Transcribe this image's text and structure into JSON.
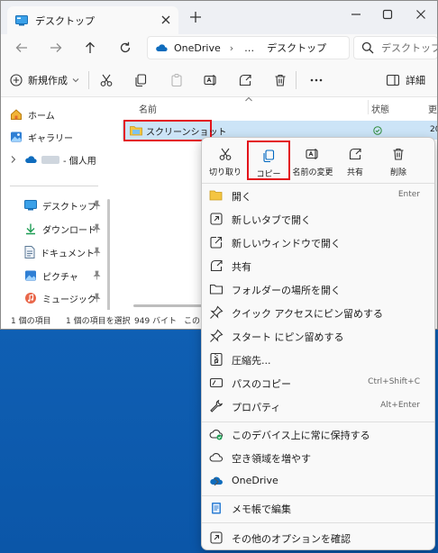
{
  "window": {
    "tab_title": "デスクトップ",
    "address_root": "OneDrive",
    "address_more": "…",
    "address_current": "デスクトップ",
    "search_placeholder": "デスクトップ"
  },
  "commandbar": {
    "new_label": "新規作成",
    "details_label": "詳細"
  },
  "sidebar": {
    "items": [
      {
        "label": "ホーム"
      },
      {
        "label": "ギャラリー"
      },
      {
        "label": "- 個人用"
      },
      {
        "label": "デスクトップ"
      },
      {
        "label": "ダウンロード"
      },
      {
        "label": "ドキュメント"
      },
      {
        "label": "ピクチャ"
      },
      {
        "label": "ミュージック"
      }
    ]
  },
  "filelist": {
    "col_name": "名前",
    "col_status": "状態",
    "col_updated": "更",
    "file": {
      "name": "スクリーンショット",
      "updated": "20"
    }
  },
  "statusbar": {
    "count": "1 個の項目",
    "selected": "1 個の項目を選択",
    "size": "949 バイト",
    "extra": "この"
  },
  "context_menu": {
    "toolbar": [
      {
        "label": "切り取り"
      },
      {
        "label": "コピー"
      },
      {
        "label": "名前の変更"
      },
      {
        "label": "共有"
      },
      {
        "label": "削除"
      }
    ],
    "items": [
      {
        "label": "開く",
        "shortcut": "Enter"
      },
      {
        "label": "新しいタブで開く"
      },
      {
        "label": "新しいウィンドウで開く"
      },
      {
        "label": "共有"
      },
      {
        "label": "フォルダーの場所を開く"
      },
      {
        "label": "クイック アクセスにピン留めする"
      },
      {
        "label": "スタート にピン留めする"
      },
      {
        "label": "圧縮先..."
      },
      {
        "label": "パスのコピー",
        "shortcut": "Ctrl+Shift+C"
      },
      {
        "label": "プロパティ",
        "shortcut": "Alt+Enter"
      },
      {
        "label": "このデバイス上に常に保持する"
      },
      {
        "label": "空き領域を増やす"
      },
      {
        "label": "OneDrive"
      },
      {
        "label": "メモ帳で編集"
      },
      {
        "label": "その他のオプションを確認"
      }
    ]
  },
  "colors": {
    "accent": "#0067c0",
    "highlight_box": "#e3141b",
    "selection": "#cce4f7",
    "desktop": "#0f5fb3"
  }
}
